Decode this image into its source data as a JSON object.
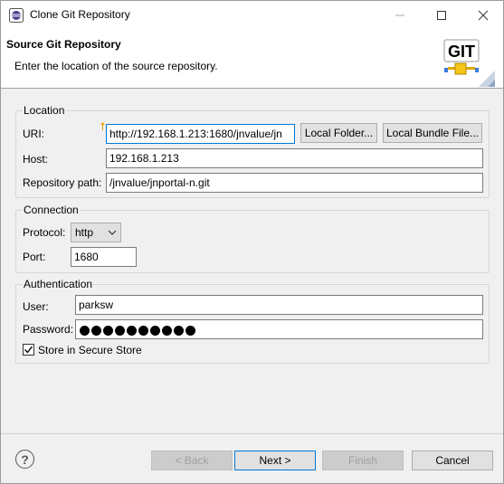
{
  "window": {
    "title": "Clone Git Repository"
  },
  "header": {
    "title": "Source Git Repository",
    "description": "Enter the location of the source repository.",
    "logo_text": "GIT"
  },
  "location": {
    "group_title": "Location",
    "uri_label": "URI:",
    "uri_value": "http://192.168.1.213:1680/jnvalue/jn",
    "local_folder_label": "Local Folder...",
    "local_bundle_label": "Local Bundle File...",
    "host_label": "Host:",
    "host_value": "192.168.1.213",
    "repo_path_label": "Repository path:",
    "repo_path_value": "/jnvalue/jnportal-n.git"
  },
  "connection": {
    "group_title": "Connection",
    "protocol_label": "Protocol:",
    "protocol_value": "http",
    "port_label": "Port:",
    "port_value": "1680"
  },
  "authentication": {
    "group_title": "Authentication",
    "user_label": "User:",
    "user_value": "parksw",
    "password_label": "Password:",
    "password_length": 10,
    "store_label": "Store in Secure Store",
    "store_checked": true
  },
  "footer": {
    "help_label": "?",
    "back_label": "< Back",
    "next_label": "Next >",
    "finish_label": "Finish",
    "cancel_label": "Cancel"
  },
  "colors": {
    "accent": "#0078d7",
    "window_bg": "#f0f0f0",
    "header_bg": "#ffffff"
  }
}
